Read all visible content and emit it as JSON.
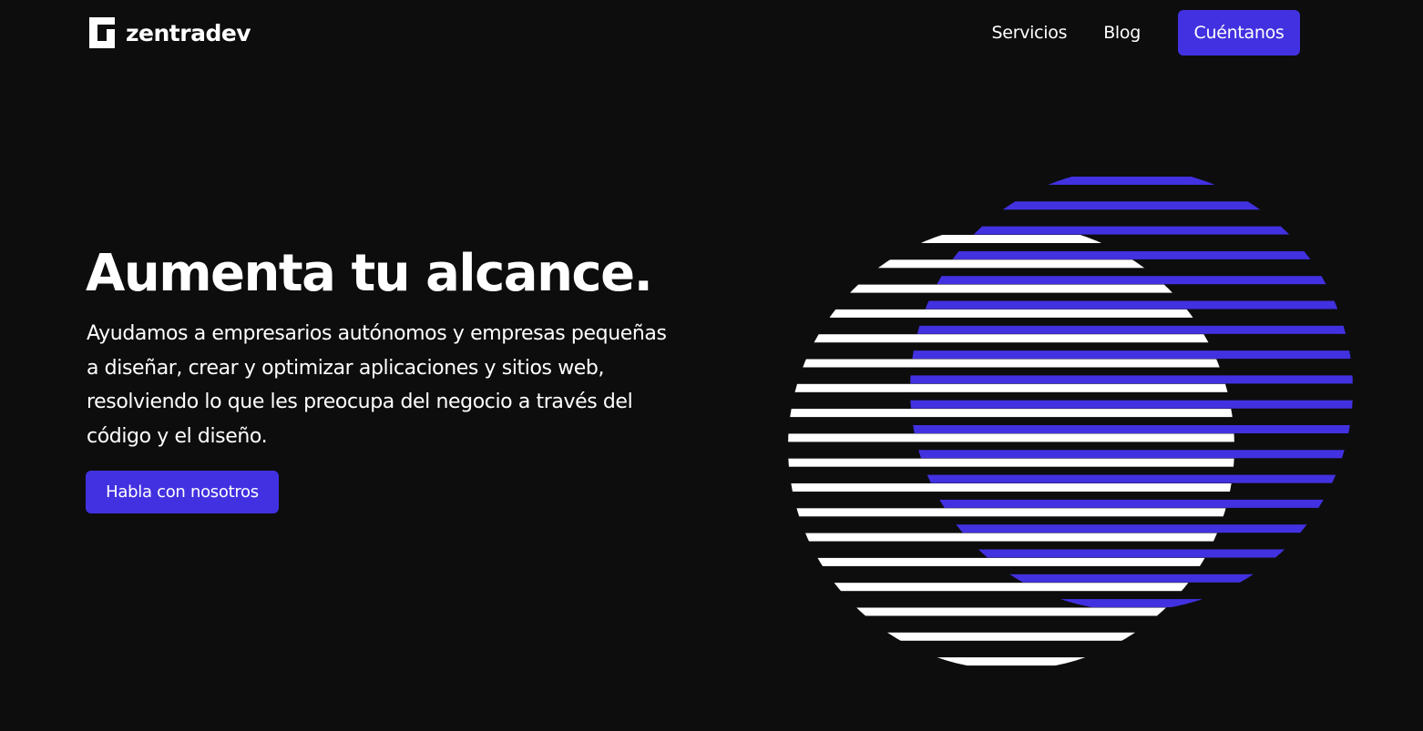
{
  "brand": {
    "name": "zentradev"
  },
  "nav": {
    "items": [
      {
        "label": "Servicios"
      },
      {
        "label": "Blog"
      }
    ],
    "cta_label": "Cuéntanos"
  },
  "hero": {
    "title": "Aumenta tu alcance.",
    "description": "Ayudamos a empresarios autónomos y empresas pequeñas a diseñar, crear y optimizar aplicaciones y sitios web, resolviendo lo que les preocupa del negocio a través del código y el diseño.",
    "cta_label": "Habla con nosotros"
  },
  "colors": {
    "background": "#0d0d0d",
    "accent": "#4231e0",
    "text": "#ffffff"
  },
  "icons": {
    "logo": "zentradev-logo-icon",
    "illustration": "striped-circles-illustration"
  }
}
